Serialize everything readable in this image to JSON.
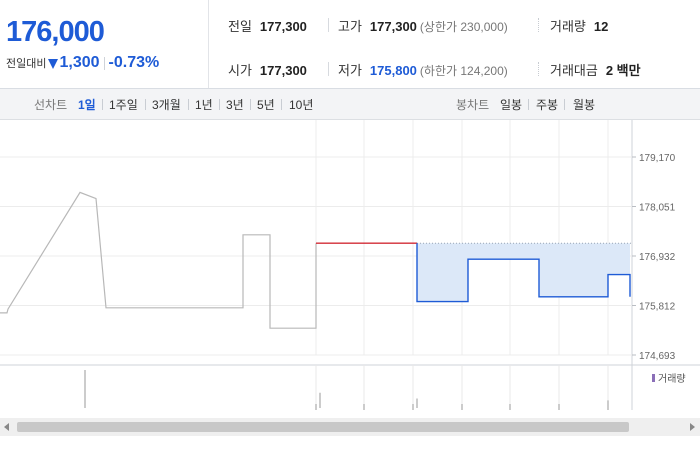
{
  "summary": {
    "current_price": "176,000",
    "change_label": "전일대비",
    "change_amount": "1,300",
    "change_percent": "-0.73%",
    "change_direction": "down",
    "stats": {
      "prev_close": {
        "label": "전일",
        "value": "177,300"
      },
      "high": {
        "label": "고가",
        "value": "177,300",
        "limit": "(상한가 230,000)"
      },
      "volume": {
        "label": "거래량",
        "value": "12"
      },
      "open": {
        "label": "시가",
        "value": "177,300"
      },
      "low": {
        "label": "저가",
        "value": "175,800",
        "limit": "(하한가 124,200)"
      },
      "trade_value": {
        "label": "거래대금",
        "value": "2 백만"
      }
    }
  },
  "tabs": {
    "line_title": "선차트",
    "line": [
      "1일",
      "1주일",
      "3개월",
      "1년",
      "3년",
      "5년",
      "10년"
    ],
    "line_active": "1일",
    "candle_title": "봉차트",
    "candle": [
      "일봉",
      "주봉",
      "월봉"
    ]
  },
  "colors": {
    "accent_blue": "#1e5bd6",
    "up_red": "#d22b36",
    "line_gray": "#b8b8b8",
    "fill_blue": "#dce8f8"
  },
  "chart_data": {
    "type": "line",
    "ylim": [
      174693,
      179170
    ],
    "yticks": [
      "179,170",
      "178,051",
      "176,932",
      "175,812",
      "174,693"
    ],
    "previous_day_series": {
      "x": [
        0,
        7,
        8,
        80,
        80,
        96,
        96,
        106,
        106,
        243,
        243,
        270,
        270,
        316,
        316
      ],
      "y": [
        175645,
        175645,
        175730,
        178370,
        178370,
        178230,
        178230,
        175760,
        175760,
        175760,
        177410,
        177410,
        175300,
        175300,
        177220
      ]
    },
    "today_series": {
      "x": [
        316,
        417
      ],
      "y": [
        177220,
        177220
      ],
      "color": "up_red"
    },
    "today_below_prev": {
      "x": [
        417,
        417,
        468,
        468,
        539,
        539,
        608,
        608,
        630,
        630
      ],
      "y": [
        177220,
        175900,
        175900,
        176860,
        176860,
        176010,
        176010,
        176510,
        176510,
        176010
      ],
      "baseline": 177220
    },
    "volume_legend": "거래량",
    "volume_bars": [
      {
        "x": 85,
        "v": 1.0
      },
      {
        "x": 320,
        "v": 0.4
      },
      {
        "x": 417,
        "v": 0.25
      },
      {
        "x": 608,
        "v": 0.2
      }
    ],
    "x_tick_positions": [
      316,
      364,
      413,
      462,
      510,
      559,
      608
    ]
  }
}
